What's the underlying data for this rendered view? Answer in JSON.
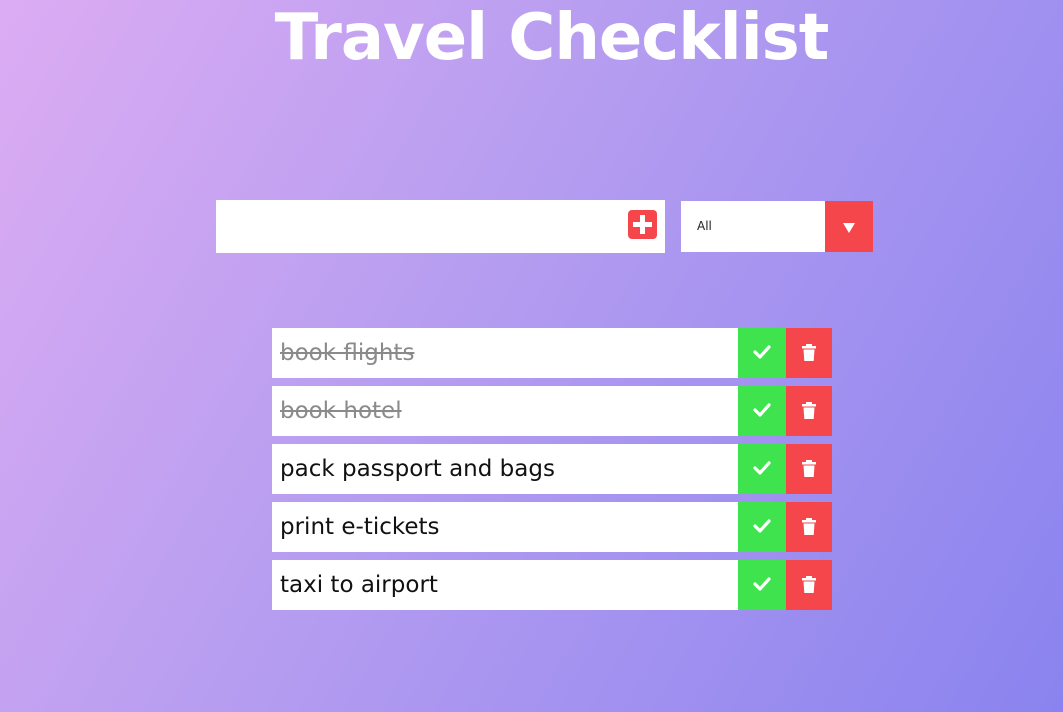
{
  "header": {
    "title": "Travel Checklist"
  },
  "add_form": {
    "input_value": "",
    "input_placeholder": "",
    "add_icon": "plus-square-icon"
  },
  "filter": {
    "selected": "All",
    "arrow_icon": "caret-down-icon"
  },
  "todos": [
    {
      "text": "book flights",
      "completed": true
    },
    {
      "text": "book hotel",
      "completed": true
    },
    {
      "text": "pack passport and bags",
      "completed": false
    },
    {
      "text": "print e-tickets",
      "completed": false
    },
    {
      "text": "taxi to airport",
      "completed": false
    }
  ],
  "icons": {
    "complete": "check-icon",
    "delete": "trash-icon"
  },
  "colors": {
    "accent_red": "#f4464b",
    "accent_green": "#3ee34d",
    "gradient_start": "#dcacf3",
    "gradient_end": "#8a83ef",
    "completed_text": "#8a8a8a"
  }
}
